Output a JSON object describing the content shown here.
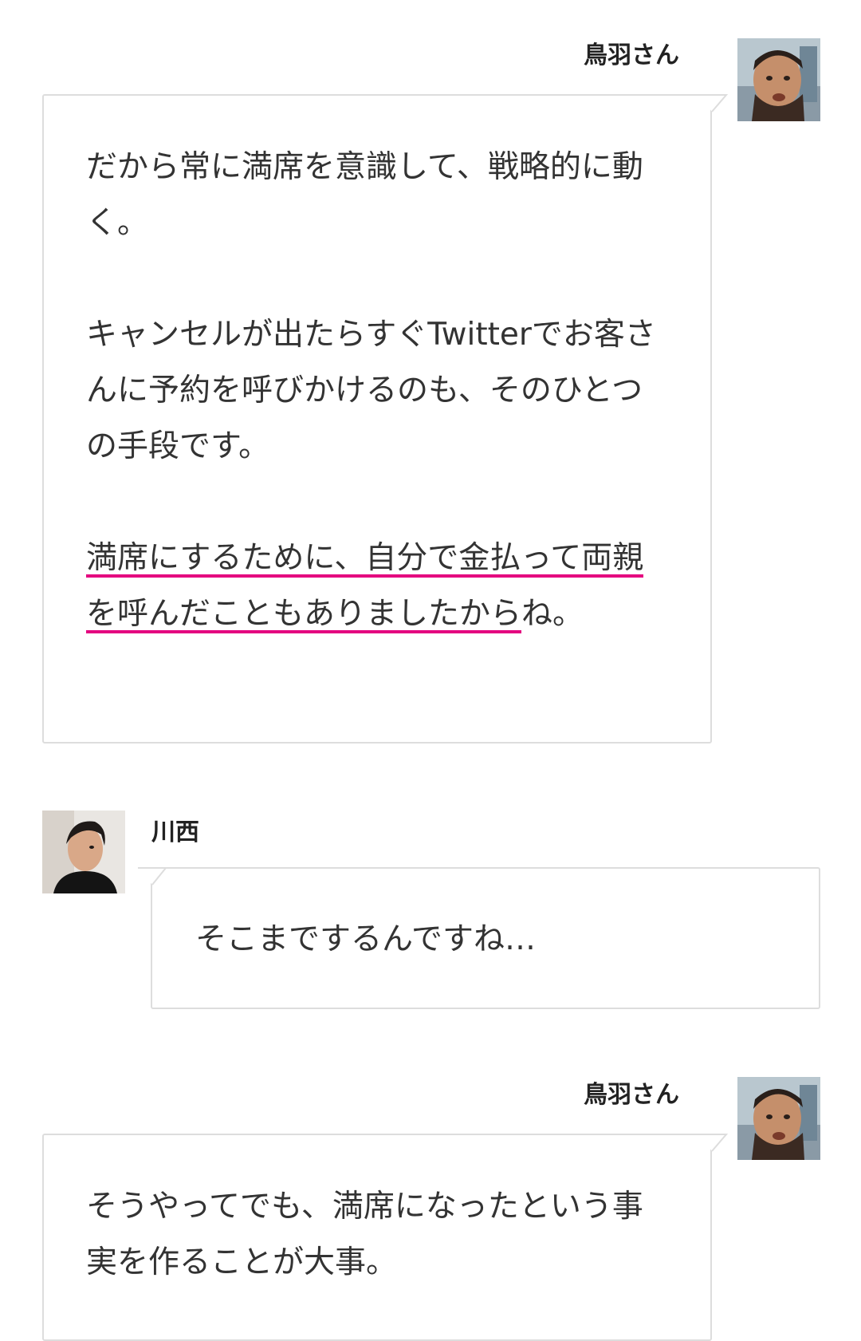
{
  "conversation": {
    "messages": [
      {
        "speaker": "鳥羽さん",
        "avatar_icon": "person-avatar-icon",
        "side": "right",
        "paragraphs": [
          {
            "text": "だから常に満席を意識して、戦略的に動く。"
          },
          {
            "text": "キャンセルが出たらすぐTwitterでお客さんに予約を呼びかけるのも、そのひとつの手段です。"
          },
          {
            "highlight": "満席にするために、自分で金払って両親を呼んだこともありましたから",
            "after": "ね。"
          }
        ]
      },
      {
        "speaker": "川西",
        "avatar_icon": "person-avatar-icon",
        "side": "left",
        "paragraphs": [
          {
            "text": "そこまでするんですね…"
          }
        ]
      },
      {
        "speaker": "鳥羽さん",
        "avatar_icon": "person-avatar-icon",
        "side": "right",
        "paragraphs": [
          {
            "text": "そうやってでも、満席になったという事実を作ることが大事。"
          }
        ]
      }
    ]
  },
  "colors": {
    "highlight_underline": "#e4007f",
    "highlight_marker": "#fff38a",
    "bubble_border": "#dddddd",
    "text": "#333333"
  }
}
